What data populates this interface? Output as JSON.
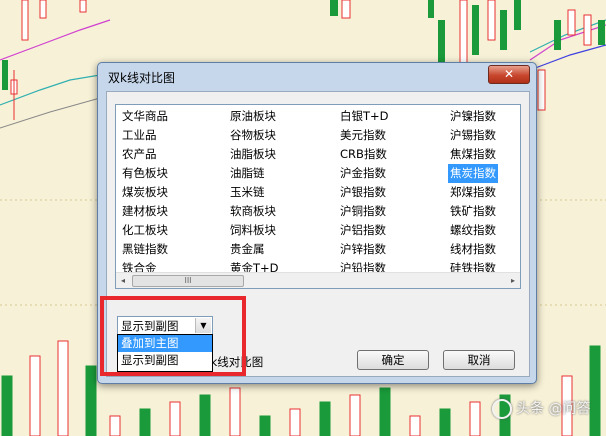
{
  "dialog": {
    "title": "双k线对比图",
    "close_glyph": "✕"
  },
  "list": {
    "columns": [
      [
        "文华商品",
        "工业品",
        "农产品",
        "有色板块",
        "煤炭板块",
        "建材板块",
        "化工板块",
        "黑链指数",
        "铁合金"
      ],
      [
        "原油板块",
        "谷物板块",
        "油脂板块",
        "油脂链",
        "玉米链",
        "软商板块",
        "饲料板块",
        "贵金属",
        "黄金T+D"
      ],
      [
        "白银T+D",
        "美元指数",
        "CRB指数",
        "沪金指数",
        "沪银指数",
        "沪铜指数",
        "沪铝指数",
        "沪锌指数",
        "沪铅指数"
      ],
      [
        "沪镍指数",
        "沪锡指数",
        "焦煤指数",
        "焦炭指数",
        "郑煤指数",
        "铁矿指数",
        "螺纹指数",
        "线材指数",
        "硅铁指数"
      ]
    ],
    "selected_item": "焦炭指数",
    "scroll_left_glyph": "◂",
    "scroll_right_glyph": "▸",
    "scroll_thumb_grip": "III"
  },
  "combo": {
    "value": "显示到副图",
    "arrow_glyph": "▼",
    "options": [
      "叠加到主图",
      "显示到副图"
    ],
    "highlighted_option": "叠加到主图"
  },
  "hint_text": "Alt+T显示/隐藏双k线对比图",
  "buttons": {
    "ok": "确定",
    "cancel": "取消"
  },
  "watermark": "头条 @问答",
  "colors": {
    "highlight": "#3399ff",
    "annotation_red": "#e8282c",
    "candle_up": "#e83030",
    "candle_down": "#1a9a3a"
  }
}
